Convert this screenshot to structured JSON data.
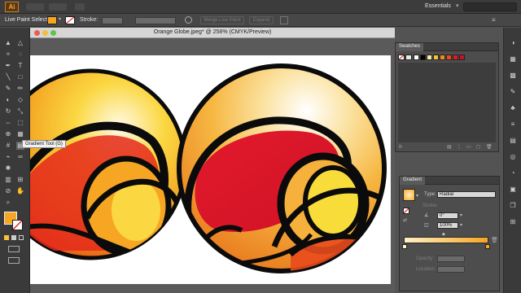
{
  "app": {
    "logo": "Ai",
    "workspace": "Essentials"
  },
  "control_bar": {
    "mode_label": "Live Paint Select",
    "stroke_label": "Stroke:",
    "merge_label": "Merge Live Paint",
    "expand_label": "Expand"
  },
  "document": {
    "title": "Orange Globe.jpeg* @ 258% (CMYK/Preview)"
  },
  "tooltip": {
    "text": "Gradient Tool (G)"
  },
  "swatches": {
    "title": "Swatches",
    "colors": [
      "#ffffff",
      "#000000",
      "#f6e9a6",
      "#f6c23c",
      "#f08a1e",
      "#e84b1c",
      "#d81e2a",
      "#c4142a"
    ]
  },
  "gradient": {
    "title": "Gradient",
    "type_label": "Type:",
    "type_value": "Radial",
    "stroke_label": "Stroke:",
    "angle_value": "0°",
    "aspect_value": "100%",
    "opacity_label": "Opacity:",
    "location_label": "Location:",
    "start_color": "#fff1c4",
    "end_color": "#f6a623"
  },
  "colors": {
    "fill_swatch": "#f6a623",
    "accent": "#f2a23c"
  }
}
